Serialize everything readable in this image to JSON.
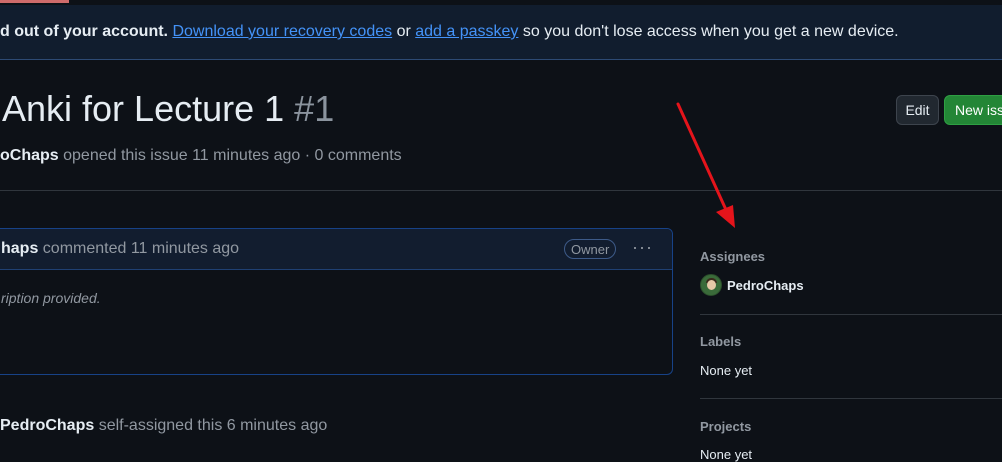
{
  "banner": {
    "lead": "d out of your account.",
    "link1": "Download your recovery codes",
    "mid": " or ",
    "link2": "add a passkey",
    "tail": " so you don't lose access when you get a new device."
  },
  "issue": {
    "title": "Anki for Lecture 1",
    "number": "#1",
    "author": "oChaps",
    "meta_text": " opened this issue 11 minutes ago · 0 comments"
  },
  "actions": {
    "edit_label": "Edit",
    "new_issue_label": "New issue"
  },
  "comment": {
    "author": "haps",
    "action": " commented 11 minutes ago",
    "badge": "Owner",
    "menu_glyph": "···",
    "body": "ription provided."
  },
  "timeline": {
    "actor": "PedroChaps",
    "text": " self-assigned this 6 minutes ago"
  },
  "sidebar": {
    "assignees_heading": "Assignees",
    "assignee_name": "PedroChaps",
    "labels_heading": "Labels",
    "labels_value": "None yet",
    "projects_heading": "Projects",
    "projects_value": "None yet"
  },
  "colors": {
    "accent_link": "#4493f8",
    "new_button": "#238636",
    "annotation_arrow": "#e5141b"
  }
}
